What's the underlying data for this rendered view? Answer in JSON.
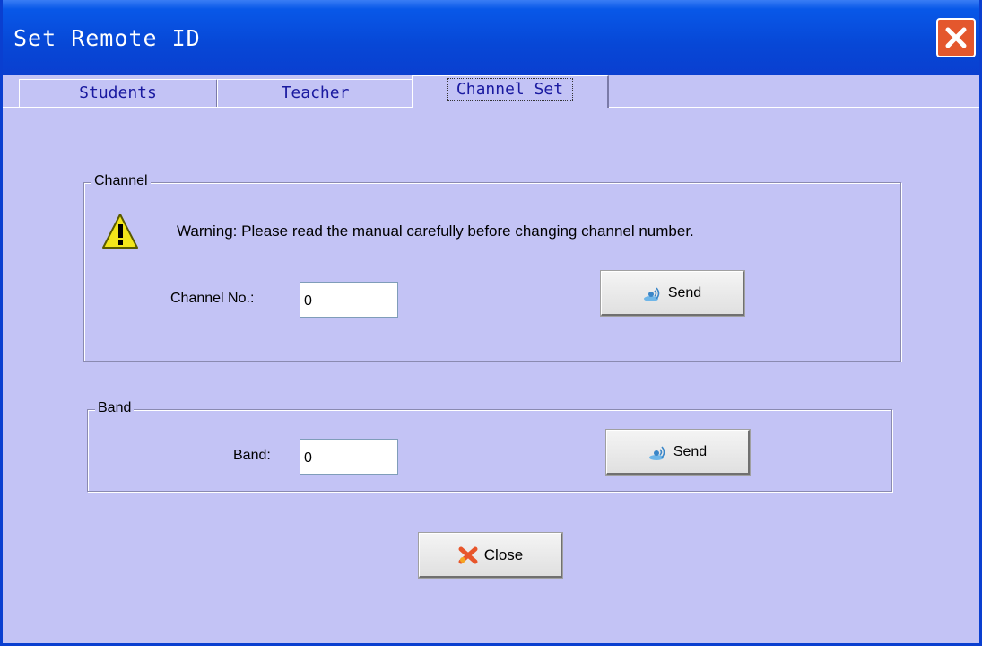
{
  "window": {
    "title": "Set Remote ID"
  },
  "tabs": [
    {
      "label": "Students"
    },
    {
      "label": "Teacher"
    },
    {
      "label": "Channel Set"
    }
  ],
  "channel_group": {
    "legend": "Channel",
    "warning": "Warning: Please read the manual carefully before changing channel number.",
    "field_label": "Channel No.:",
    "field_value": "0",
    "send_label": "Send"
  },
  "band_group": {
    "legend": "Band",
    "field_label": "Band:",
    "field_value": "0",
    "send_label": "Send"
  },
  "footer": {
    "close_label": "Close"
  },
  "colors": {
    "background": "#c3c3f5",
    "titlebar": "#0747d6",
    "close": "#e4572d"
  }
}
